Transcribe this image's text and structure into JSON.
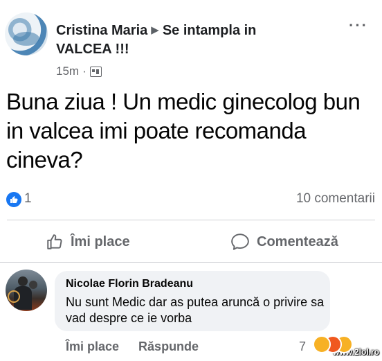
{
  "post": {
    "author": "Cristina Maria",
    "group_line1": "Se intampla in",
    "group_line2": "VALCEA !!!",
    "time": "15m",
    "text": "Buna ziua ! Un medic ginecolog bun in valcea imi poate recomanda cineva?",
    "reactions_count": "1",
    "comments_count": "10 comentarii",
    "more_icon": "···"
  },
  "actions": {
    "like_label": "Îmi place",
    "comment_label": "Comentează"
  },
  "comment": {
    "author": "Nicolae Florin Bradeanu",
    "text": "Nu sunt Medic dar as putea aruncă o privire sa vad despre ce ie vorba",
    "like_label": "Îmi place",
    "reply_label": "Răspunde",
    "reactions_count": "7"
  },
  "watermark": "www.2lol.ro",
  "colors": {
    "accent": "#1877f2",
    "muted": "#65676b",
    "bubble": "#f0f2f5"
  }
}
